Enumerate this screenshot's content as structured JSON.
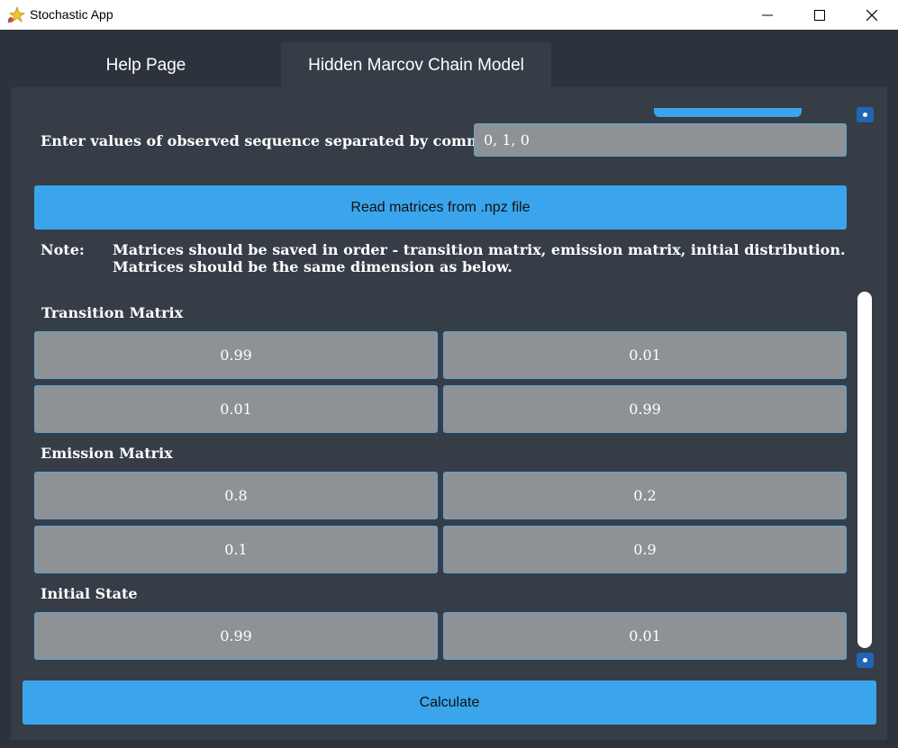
{
  "window": {
    "title": "Stochastic App",
    "controls": [
      "minimize",
      "maximize",
      "close"
    ]
  },
  "tabs": [
    {
      "label": "Help Page",
      "active": false
    },
    {
      "label": "Hidden Marcov Chain Model",
      "active": true
    }
  ],
  "sequence": {
    "label": "Enter values of observed sequence separated by comma :",
    "value": "0, 1, 0"
  },
  "read_button": {
    "label": "Read matrices from .npz file"
  },
  "note": {
    "label": "Note:",
    "line1": "Matrices should be saved in order - transition matrix, emission matrix, initial distribution.",
    "line2": "Matrices should be the same dimension as below."
  },
  "transition": {
    "title": "Transition Matrix",
    "rows": [
      [
        "0.99",
        "0.01"
      ],
      [
        "0.01",
        "0.99"
      ]
    ]
  },
  "emission": {
    "title": "Emission Matrix",
    "rows": [
      [
        "0.8",
        "0.2"
      ],
      [
        "0.1",
        "0.9"
      ]
    ]
  },
  "initial": {
    "title": "Initial State",
    "row": [
      "0.99",
      "0.01"
    ]
  },
  "calculate_button": {
    "label": "Calculate"
  },
  "colors": {
    "accent": "#3aa5ec",
    "background": "#2d333c",
    "panel": "#363d47",
    "field": "#8e9196",
    "field_border": "#5aa7d8",
    "scroll_button": "#1f66b6"
  }
}
